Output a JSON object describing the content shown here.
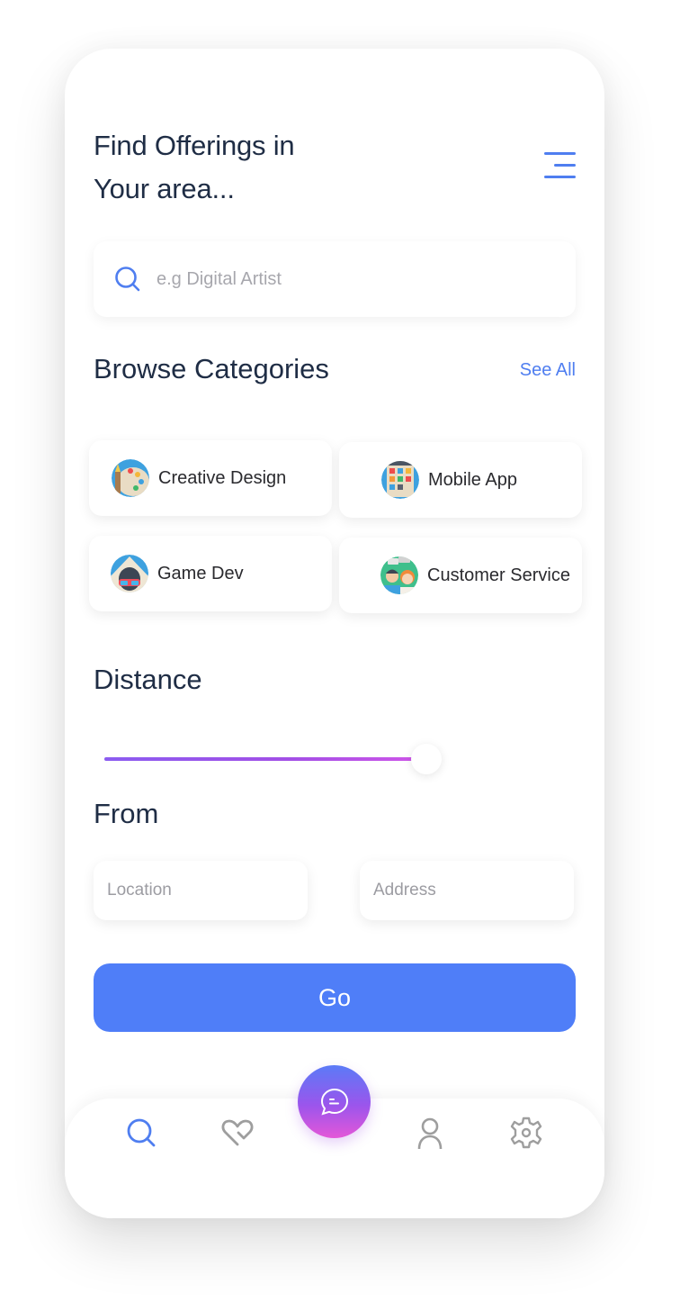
{
  "header": {
    "title_line1": "Find Offerings in",
    "title_line2": "Your area...",
    "menu_icon": "menu-icon"
  },
  "search": {
    "placeholder": "e.g Digital Artist",
    "value": "",
    "icon": "search-icon"
  },
  "categories": {
    "heading": "Browse Categories",
    "see_all_label": "See All",
    "items": [
      {
        "label": "Creative Design",
        "icon": "palette-icon"
      },
      {
        "label": "Mobile App",
        "icon": "mobile-app-icon"
      },
      {
        "label": "Game Dev",
        "icon": "game-dev-icon"
      },
      {
        "label": "Customer Service",
        "icon": "customer-service-icon"
      }
    ]
  },
  "distance": {
    "heading": "Distance",
    "slider_value_percent": 66
  },
  "from": {
    "heading": "From",
    "location_placeholder": "Location",
    "address_placeholder": "Address"
  },
  "go_button": {
    "label": "Go"
  },
  "bottom_nav": {
    "items": [
      {
        "name": "search",
        "icon": "search-icon",
        "active": true
      },
      {
        "name": "favorites",
        "icon": "heart-icon",
        "active": false
      },
      {
        "name": "chat",
        "icon": "chat-icon",
        "active": false
      },
      {
        "name": "profile",
        "icon": "user-icon",
        "active": false
      },
      {
        "name": "settings",
        "icon": "gear-icon",
        "active": false
      }
    ]
  },
  "colors": {
    "accent": "#4f7ef8",
    "heading": "#1f2d45",
    "inactive_icon": "#9e9e9e",
    "fab_gradient_top": "#5b7bf7",
    "fab_gradient_bottom": "#e457d8"
  }
}
